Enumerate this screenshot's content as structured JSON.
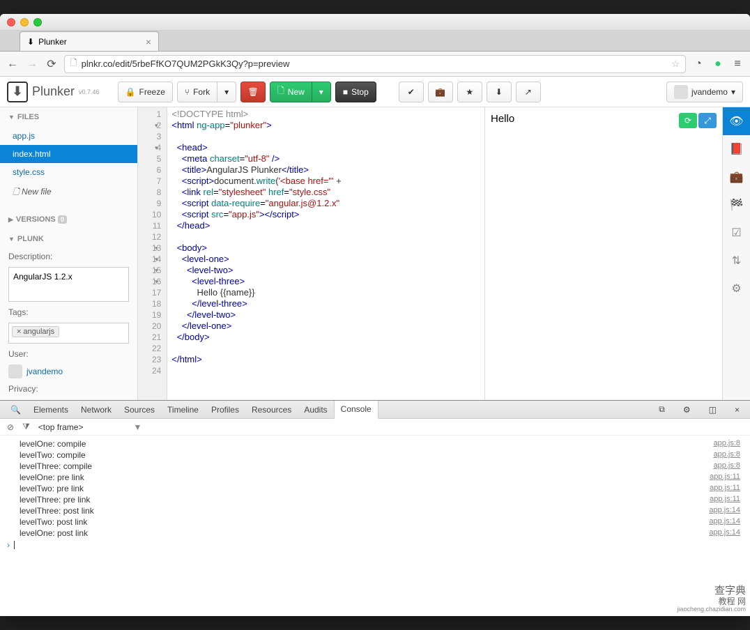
{
  "browser": {
    "tab_title": "Plunker",
    "url": "plnkr.co/edit/5rbeFfKO7QUM2PGkK3Qy?p=preview"
  },
  "app": {
    "name": "Plunker",
    "version": "v0.7.46"
  },
  "toolbar": {
    "freeze": "Freeze",
    "fork": "Fork",
    "new": "New",
    "stop": "Stop",
    "username": "jvandemo"
  },
  "sidebar": {
    "files_header": "FILES",
    "files": [
      "app.js",
      "index.html",
      "style.css"
    ],
    "active_file_index": 1,
    "new_file": "New file",
    "versions_header": "VERSIONS",
    "versions_count": "0",
    "plunk_header": "PLUNK",
    "description_label": "Description:",
    "description_value": "AngularJS 1.2.x",
    "tags_label": "Tags:",
    "tags": [
      "angularjs"
    ],
    "user_label": "User:",
    "user_name": "jvandemo",
    "privacy_label": "Privacy:"
  },
  "editor": {
    "lines": [
      {
        "n": 1,
        "fold": "",
        "html": "<span class='tk-doc'>&lt;!DOCTYPE html&gt;</span>"
      },
      {
        "n": 2,
        "fold": "▾",
        "html": "<span class='tk-tag'>&lt;html</span> <span class='tk-attr'>ng-app</span>=<span class='tk-str'>\"plunker\"</span><span class='tk-tag'>&gt;</span>"
      },
      {
        "n": 3,
        "fold": "",
        "html": ""
      },
      {
        "n": 4,
        "fold": "▾",
        "html": "  <span class='tk-tag'>&lt;head&gt;</span>"
      },
      {
        "n": 5,
        "fold": "",
        "html": "    <span class='tk-tag'>&lt;meta</span> <span class='tk-attr'>charset</span>=<span class='tk-str'>\"utf-8\"</span> <span class='tk-tag'>/&gt;</span>"
      },
      {
        "n": 6,
        "fold": "",
        "html": "    <span class='tk-tag'>&lt;title&gt;</span><span class='tk-txt'>AngularJS Plunker</span><span class='tk-tag'>&lt;/title&gt;</span>"
      },
      {
        "n": 7,
        "fold": "",
        "html": "    <span class='tk-tag'>&lt;script&gt;</span><span class='tk-js'>document.</span><span class='tk-attr'>write</span><span class='tk-js'>(</span><span class='tk-str'>'&lt;base href=\"'</span> <span class='tk-js'>+</span>"
      },
      {
        "n": 8,
        "fold": "",
        "html": "    <span class='tk-tag'>&lt;link</span> <span class='tk-attr'>rel</span>=<span class='tk-str'>\"stylesheet\"</span> <span class='tk-attr'>href</span>=<span class='tk-str'>\"style.css\"</span>"
      },
      {
        "n": 9,
        "fold": "",
        "html": "    <span class='tk-tag'>&lt;script</span> <span class='tk-attr'>data-require</span>=<span class='tk-str'>\"angular.js@1.2.x\"</span>"
      },
      {
        "n": 10,
        "fold": "",
        "html": "    <span class='tk-tag'>&lt;script</span> <span class='tk-attr'>src</span>=<span class='tk-str'>\"app.js\"</span><span class='tk-tag'>&gt;&lt;/script&gt;</span>"
      },
      {
        "n": 11,
        "fold": "",
        "html": "  <span class='tk-tag'>&lt;/head&gt;</span>"
      },
      {
        "n": 12,
        "fold": "",
        "html": ""
      },
      {
        "n": 13,
        "fold": "▾",
        "html": "  <span class='tk-tag'>&lt;body&gt;</span>"
      },
      {
        "n": 14,
        "fold": "▾",
        "html": "    <span class='tk-tag'>&lt;level-one&gt;</span>"
      },
      {
        "n": 15,
        "fold": "▾",
        "html": "      <span class='tk-tag'>&lt;level-two&gt;</span>"
      },
      {
        "n": 16,
        "fold": "▾",
        "html": "        <span class='tk-tag'>&lt;level-three&gt;</span>"
      },
      {
        "n": 17,
        "fold": "",
        "html": "          <span class='tk-txt'>Hello {{name}}</span>"
      },
      {
        "n": 18,
        "fold": "",
        "html": "        <span class='tk-tag'>&lt;/level-three&gt;</span>"
      },
      {
        "n": 19,
        "fold": "",
        "html": "      <span class='tk-tag'>&lt;/level-two&gt;</span>"
      },
      {
        "n": 20,
        "fold": "",
        "html": "    <span class='tk-tag'>&lt;/level-one&gt;</span>"
      },
      {
        "n": 21,
        "fold": "",
        "html": "  <span class='tk-tag'>&lt;/body&gt;</span>"
      },
      {
        "n": 22,
        "fold": "",
        "html": ""
      },
      {
        "n": 23,
        "fold": "",
        "html": "<span class='tk-tag'>&lt;/html&gt;</span>"
      },
      {
        "n": 24,
        "fold": "",
        "html": ""
      }
    ]
  },
  "preview": {
    "output": "Hello"
  },
  "devtools": {
    "tabs": [
      "Elements",
      "Network",
      "Sources",
      "Timeline",
      "Profiles",
      "Resources",
      "Audits",
      "Console"
    ],
    "active_tab_index": 7,
    "frame_selector": "<top frame>",
    "logs": [
      {
        "msg": "levelOne: compile",
        "src": "app.js:8"
      },
      {
        "msg": "levelTwo: compile",
        "src": "app.js:8"
      },
      {
        "msg": "levelThree: compile",
        "src": "app.js:8"
      },
      {
        "msg": "levelOne: pre link",
        "src": "app.js:11"
      },
      {
        "msg": "levelTwo: pre link",
        "src": "app.js:11"
      },
      {
        "msg": "levelThree: pre link",
        "src": "app.js:11"
      },
      {
        "msg": "levelThree: post link",
        "src": "app.js:14"
      },
      {
        "msg": "levelTwo: post link",
        "src": "app.js:14"
      },
      {
        "msg": "levelOne: post link",
        "src": "app.js:14"
      }
    ]
  },
  "watermark": {
    "main": "查字典",
    "sub": "教程 网",
    "url": "jiaocheng.chazidian.com"
  }
}
